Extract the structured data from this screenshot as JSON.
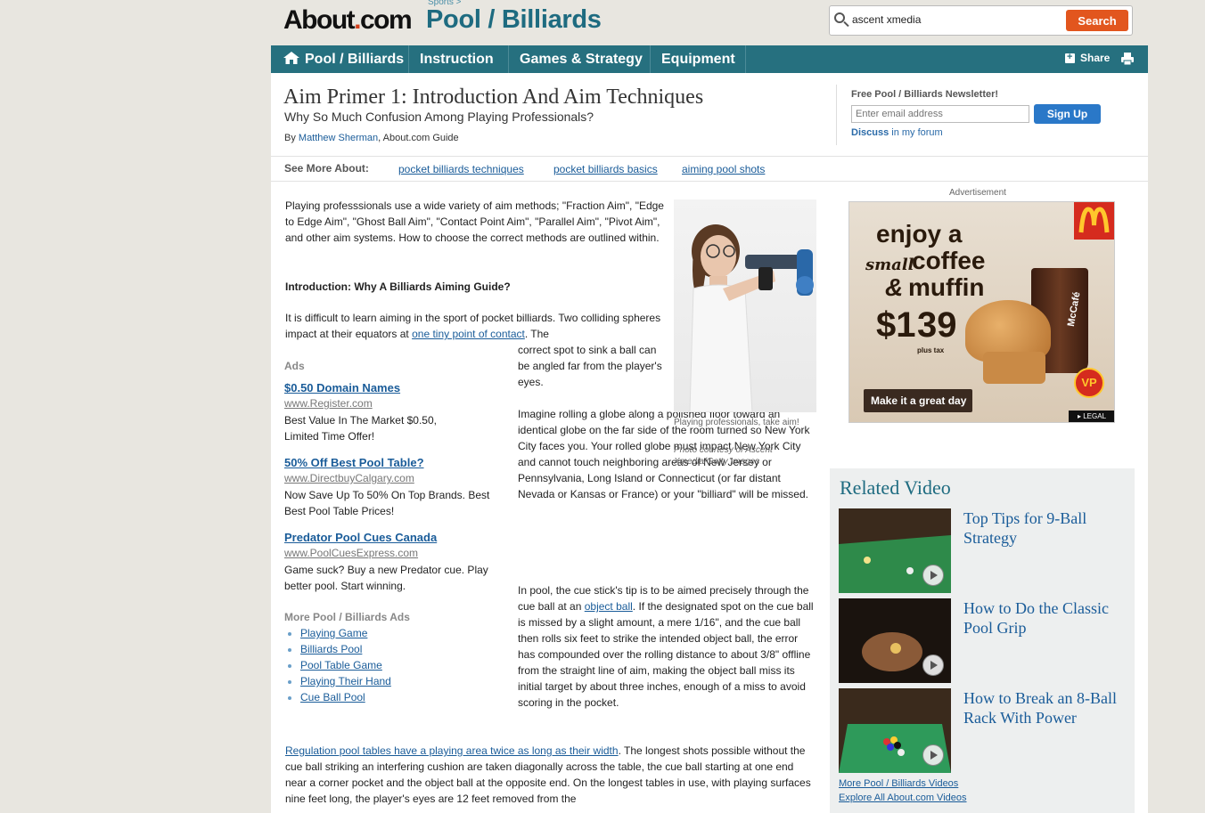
{
  "header": {
    "logo_text": "About",
    "logo_dot": ".",
    "logo_com": "com",
    "section_parent": "Sports >",
    "section_title": "Pool / Billiards",
    "search_value": "ascent xmedia",
    "search_button": "Search"
  },
  "nav": {
    "items": [
      {
        "label": "Pool / Billiards",
        "icon": "home-icon"
      },
      {
        "label": "Instruction"
      },
      {
        "label": "Games & Strategy"
      },
      {
        "label": "Equipment"
      }
    ],
    "share_label": "Share"
  },
  "article": {
    "title": "Aim Primer 1: Introduction And Aim Techniques",
    "subtitle": "Why So Much Confusion Among Playing Professionals?",
    "by_prefix": "By",
    "author": "Matthew Sherman",
    "author_suffix": ", About.com Guide",
    "para1": "Playing professsionals use a wide variety of aim methods; \"Fraction Aim\", \"Edge to Edge Aim\", \"Ghost Ball Aim\", \"Contact Point Aim\", \"Parallel Aim\", \"Pivot Aim\", and other aim systems. How to choose the correct methods are outlined within.",
    "intro_heading": "Introduction: Why A Billiards Aiming Guide?",
    "para2_start": "It is difficult to learn aiming in the sport of pocket billiards. Two colliding spheres impact at their equators at",
    "para2_link": "one tiny point of contact",
    "para2_end": ". The",
    "para2b": "correct spot to sink a ball can be angled far from the player's eyes.",
    "para3": "Imagine rolling a globe along a polished floor toward an identical globe on the far side of the room turned so New York City faces you. Your rolled globe must impact New York City and cannot touch neighboring areas of New Jersey or Pennsylvania, Long Island or Connecticut (or far distant Nevada or Kansas or France) or your \"billiard\" will be missed.",
    "para4_start": "In pool, the cue stick's tip is to be aimed precisely through the cue ball at an",
    "para4_link": "object ball",
    "para4_end": ". If the designated spot on the cue ball is missed by a slight amount, a mere 1/16\", and the cue ball then rolls six feet to strike the intended object ball, the error has compounded over the rolling distance to about 3/8\" offline from the straight line of aim, making the object ball miss its initial target by about three inches, enough of a miss to avoid scoring in the pocket.",
    "para5_link": "Regulation pool tables have a playing area twice as long as their width",
    "para5_end": ". The longest shots possible without the cue ball striking an interfering cushion are taken diagonally across the table, the cue ball starting at one end near a corner pocket and the object ball at the opposite end. On the longest tables in use, with playing surfaces nine feet long, the player's eyes are 12 feet removed from the"
  },
  "newsletter": {
    "title": "Free Pool / Billiards Newsletter!",
    "email_placeholder": "Enter email address",
    "signup_label": "Sign Up",
    "discuss": "Discuss",
    "discuss_suffix": " in my forum"
  },
  "see_more": {
    "label": "See More About:",
    "links": [
      "pocket billiards techniques",
      "pocket billiards basics",
      "aiming pool shots"
    ]
  },
  "ads": {
    "label": "Ads",
    "items": [
      {
        "title": "$0.50 Domain Names",
        "url": "www.Register.com",
        "desc": "Best Value In The Market $0.50, Limited Time Offer!"
      },
      {
        "title": "50% Off Best Pool Table?",
        "url": "www.DirectbuyCalgary.com",
        "desc": "Now Save Up To 50% On Top Brands. Best Best Pool Table Prices!"
      },
      {
        "title": "Predator Pool Cues Canada",
        "url": "www.PoolCuesExpress.com",
        "desc": "Game suck? Buy a new Predator cue. Play better pool. Start winning."
      }
    ],
    "more_label": "More Pool / Billiards Ads",
    "more_links": [
      "Playing Game",
      "Billiards Pool",
      "Pool Table Game",
      "Playing Their Hand",
      "Cue Ball Pool"
    ]
  },
  "photo": {
    "caption": "Playing professionals, take aim!",
    "credit": "Photo courtesy of Ascent Xmedia/Getty Images"
  },
  "advertisement": {
    "label": "Advertisement",
    "line1": "enjoy a",
    "line2a": "small",
    "line2b": "coffee",
    "line3a": "&",
    "line3b": "muffin",
    "price": "$1",
    "price_cents": "39",
    "plus_tax": "plus tax",
    "cta": "Make it a great day",
    "legal": "LEGAL",
    "badge": "VP",
    "cup_text": "McCafé"
  },
  "related": {
    "title": "Related Video",
    "videos": [
      {
        "title": "Top Tips for 9-Ball Strategy"
      },
      {
        "title": "How to Do the Classic Pool Grip"
      },
      {
        "title": "How to Break an 8-Ball Rack With Power"
      }
    ],
    "more_link": "More Pool / Billiards Videos",
    "explore_link": "Explore All About.com Videos"
  },
  "colors": {
    "nav": "#26707f",
    "brand_title": "#1e6b80",
    "search_button": "#e2561e",
    "signup_button": "#2a78c8",
    "link": "#1a5c99"
  }
}
